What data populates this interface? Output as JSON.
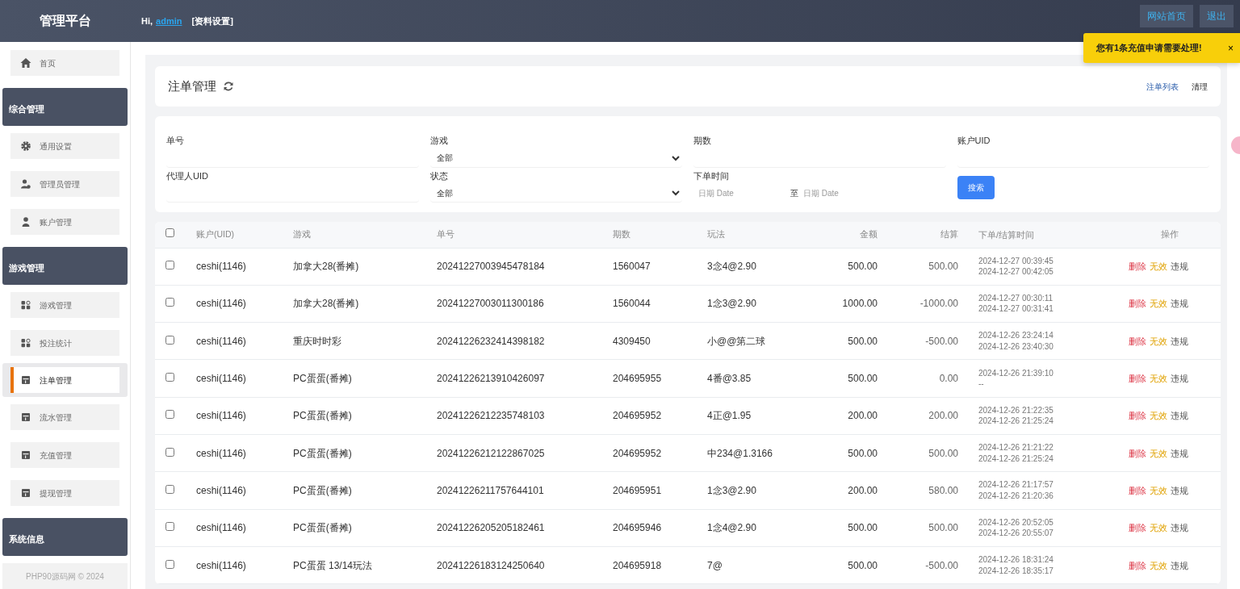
{
  "header": {
    "brand": "管理平台",
    "greeting": "Hi,",
    "user": "admin",
    "profile_link": "[资料设置]",
    "buttons": [
      "网站首页",
      "退出"
    ]
  },
  "toast": {
    "message": "您有1条充值申请需要处理!",
    "close": "×"
  },
  "sidebar": {
    "items": [
      {
        "kind": "link",
        "label": "首页",
        "selected": false
      },
      {
        "kind": "section",
        "label": "综合管理"
      },
      {
        "kind": "link",
        "label": "通用设置",
        "selected": false
      },
      {
        "kind": "link",
        "label": "管理员管理",
        "selected": false
      },
      {
        "kind": "link",
        "label": "账户管理",
        "selected": false
      },
      {
        "kind": "section",
        "label": "游戏管理"
      },
      {
        "kind": "link",
        "label": "游戏管理",
        "selected": false
      },
      {
        "kind": "link",
        "label": "投注统计",
        "selected": false
      },
      {
        "kind": "link",
        "label": "注单管理",
        "selected": true
      },
      {
        "kind": "link",
        "label": "流水管理",
        "selected": false
      },
      {
        "kind": "link",
        "label": "充值管理",
        "selected": false
      },
      {
        "kind": "link",
        "label": "提现管理",
        "selected": false
      },
      {
        "kind": "section",
        "label": "系统信息"
      }
    ],
    "footer": "PHP90源码网 © 2024"
  },
  "page": {
    "title": "注单管理",
    "links": [
      "注单列表",
      "清理"
    ]
  },
  "filters": [
    {
      "kind": "text",
      "label": "单号"
    },
    {
      "kind": "select",
      "label": "游戏",
      "value": "全部"
    },
    {
      "kind": "text",
      "label": "期数"
    },
    {
      "kind": "text",
      "label": "账户UID"
    },
    {
      "kind": "text",
      "label": "代理人UID"
    },
    {
      "kind": "select",
      "label": "状态",
      "value": "全部"
    },
    {
      "kind": "daterange",
      "label": "下单时间",
      "from_placeholder": "日期 Date",
      "separator": "至",
      "to_placeholder": "日期 Date"
    },
    {
      "kind": "button",
      "label": "搜索"
    }
  ],
  "table": {
    "select_all_checked": false,
    "columns": [
      "账户(UID)",
      "游戏",
      "单号",
      "期数",
      "玩法",
      "金额",
      "结算",
      "下单/结算时间",
      "操作"
    ],
    "rows": [
      {
        "checked": false,
        "account": "ceshi(1146)",
        "game": "加拿大28(番摊)",
        "order_no": "20241227003945478184",
        "period": "1560047",
        "play": "3念4@2.90",
        "amount": "500.00",
        "settle": "500.00",
        "bet_time": "2024-12-27 00:39:45",
        "settle_time": "2024-12-27 00:42:05"
      },
      {
        "checked": false,
        "account": "ceshi(1146)",
        "game": "加拿大28(番摊)",
        "order_no": "20241227003011300186",
        "period": "1560044",
        "play": "1念3@2.90",
        "amount": "1000.00",
        "settle": "-1000.00",
        "bet_time": "2024-12-27 00:30:11",
        "settle_time": "2024-12-27 00:31:41"
      },
      {
        "checked": false,
        "account": "ceshi(1146)",
        "game": "重庆时时彩",
        "order_no": "20241226232414398182",
        "period": "4309450",
        "play": "小@@第二球",
        "amount": "500.00",
        "settle": "-500.00",
        "bet_time": "2024-12-26 23:24:14",
        "settle_time": "2024-12-26 23:40:30"
      },
      {
        "checked": false,
        "account": "ceshi(1146)",
        "game": "PC蛋蛋(番摊)",
        "order_no": "20241226213910426097",
        "period": "204695955",
        "play": "4番@3.85",
        "amount": "500.00",
        "settle": "0.00",
        "bet_time": "2024-12-26 21:39:10",
        "settle_time": "--"
      },
      {
        "checked": false,
        "account": "ceshi(1146)",
        "game": "PC蛋蛋(番摊)",
        "order_no": "20241226212235748103",
        "period": "204695952",
        "play": "4正@1.95",
        "amount": "200.00",
        "settle": "200.00",
        "bet_time": "2024-12-26 21:22:35",
        "settle_time": "2024-12-26 21:25:24"
      },
      {
        "checked": false,
        "account": "ceshi(1146)",
        "game": "PC蛋蛋(番摊)",
        "order_no": "20241226212122867025",
        "period": "204695952",
        "play": "中234@1.3166",
        "amount": "500.00",
        "settle": "500.00",
        "bet_time": "2024-12-26 21:21:22",
        "settle_time": "2024-12-26 21:25:24"
      },
      {
        "checked": false,
        "account": "ceshi(1146)",
        "game": "PC蛋蛋(番摊)",
        "order_no": "20241226211757644101",
        "period": "204695951",
        "play": "1念3@2.90",
        "amount": "200.00",
        "settle": "580.00",
        "bet_time": "2024-12-26 21:17:57",
        "settle_time": "2024-12-26 21:20:36"
      },
      {
        "checked": false,
        "account": "ceshi(1146)",
        "game": "PC蛋蛋(番摊)",
        "order_no": "20241226205205182461",
        "period": "204695946",
        "play": "1念4@2.90",
        "amount": "500.00",
        "settle": "500.00",
        "bet_time": "2024-12-26 20:52:05",
        "settle_time": "2024-12-26 20:55:07"
      },
      {
        "checked": false,
        "account": "ceshi(1146)",
        "game": "PC蛋蛋 13/14玩法",
        "order_no": "20241226183124250640",
        "period": "204695918",
        "play": "7@",
        "amount": "500.00",
        "settle": "-500.00",
        "bet_time": "2024-12-26 18:31:24",
        "settle_time": "2024-12-26 18:35:17"
      }
    ],
    "row_actions": [
      [
        {
          "kind": "delete",
          "label": "删除"
        },
        {
          "kind": "invalid",
          "label": "无效"
        },
        {
          "kind": "violation",
          "label": "违规"
        }
      ],
      [
        {
          "kind": "delete",
          "label": "删除"
        },
        {
          "kind": "invalid",
          "label": "无效"
        },
        {
          "kind": "violation",
          "label": "违规"
        }
      ],
      [
        {
          "kind": "delete",
          "label": "删除"
        },
        {
          "kind": "invalid",
          "label": "无效"
        },
        {
          "kind": "violation",
          "label": "违规"
        }
      ],
      [
        {
          "kind": "delete",
          "label": "删除"
        },
        {
          "kind": "invalid",
          "label": "无效"
        },
        {
          "kind": "violation",
          "label": "违规"
        }
      ],
      [
        {
          "kind": "delete",
          "label": "删除"
        },
        {
          "kind": "invalid",
          "label": "无效"
        },
        {
          "kind": "violation",
          "label": "违规"
        }
      ],
      [
        {
          "kind": "delete",
          "label": "删除"
        },
        {
          "kind": "invalid",
          "label": "无效"
        },
        {
          "kind": "violation",
          "label": "违规"
        }
      ],
      [
        {
          "kind": "delete",
          "label": "删除"
        },
        {
          "kind": "invalid",
          "label": "无效"
        },
        {
          "kind": "violation",
          "label": "违规"
        }
      ],
      [
        {
          "kind": "delete",
          "label": "删除"
        },
        {
          "kind": "invalid",
          "label": "无效"
        },
        {
          "kind": "violation",
          "label": "违规"
        }
      ],
      [
        {
          "kind": "delete",
          "label": "删除"
        },
        {
          "kind": "invalid",
          "label": "无效"
        },
        {
          "kind": "violation",
          "label": "违规"
        }
      ]
    ]
  }
}
